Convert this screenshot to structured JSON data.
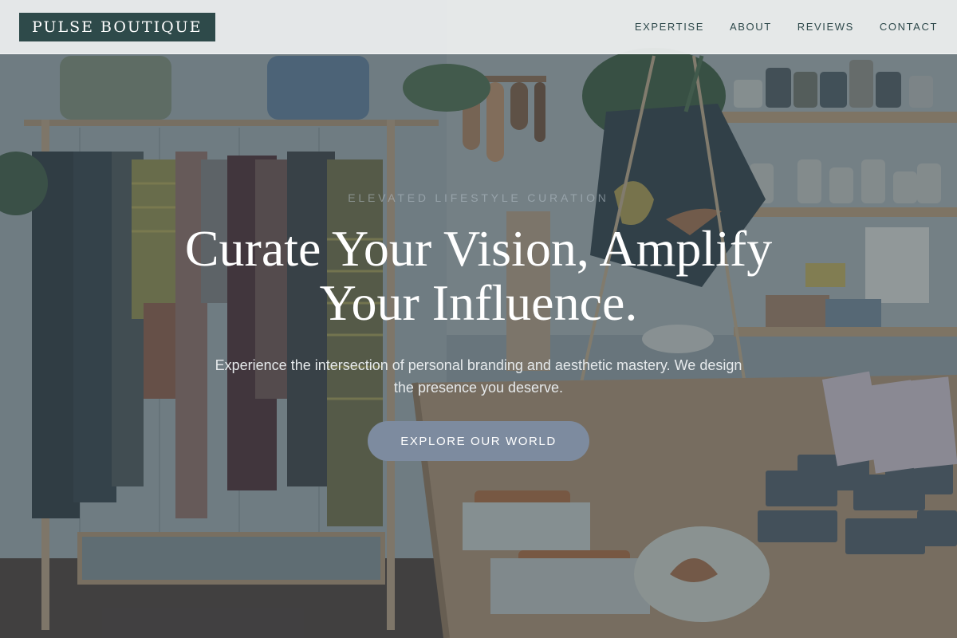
{
  "brand": {
    "name": "PULSE BOUTIQUE"
  },
  "nav": {
    "items": [
      {
        "label": "EXPERTISE"
      },
      {
        "label": "ABOUT"
      },
      {
        "label": "REVIEWS"
      },
      {
        "label": "CONTACT"
      }
    ]
  },
  "hero": {
    "eyebrow": "ELEVATED LIFESTYLE CURATION",
    "headline_line1": "Curate Your Vision, Amplify",
    "headline_line2": "Your Influence.",
    "subtext": "Experience the intersection of personal branding and aesthetic mastery. We design the presence you deserve.",
    "cta_label": "EXPLORE OUR WORLD"
  },
  "colors": {
    "logo_bg": "#2e4a4a",
    "nav_text": "#2f4a4c",
    "cta_bg": "#7d8b9f",
    "overlay": "#34424a"
  }
}
